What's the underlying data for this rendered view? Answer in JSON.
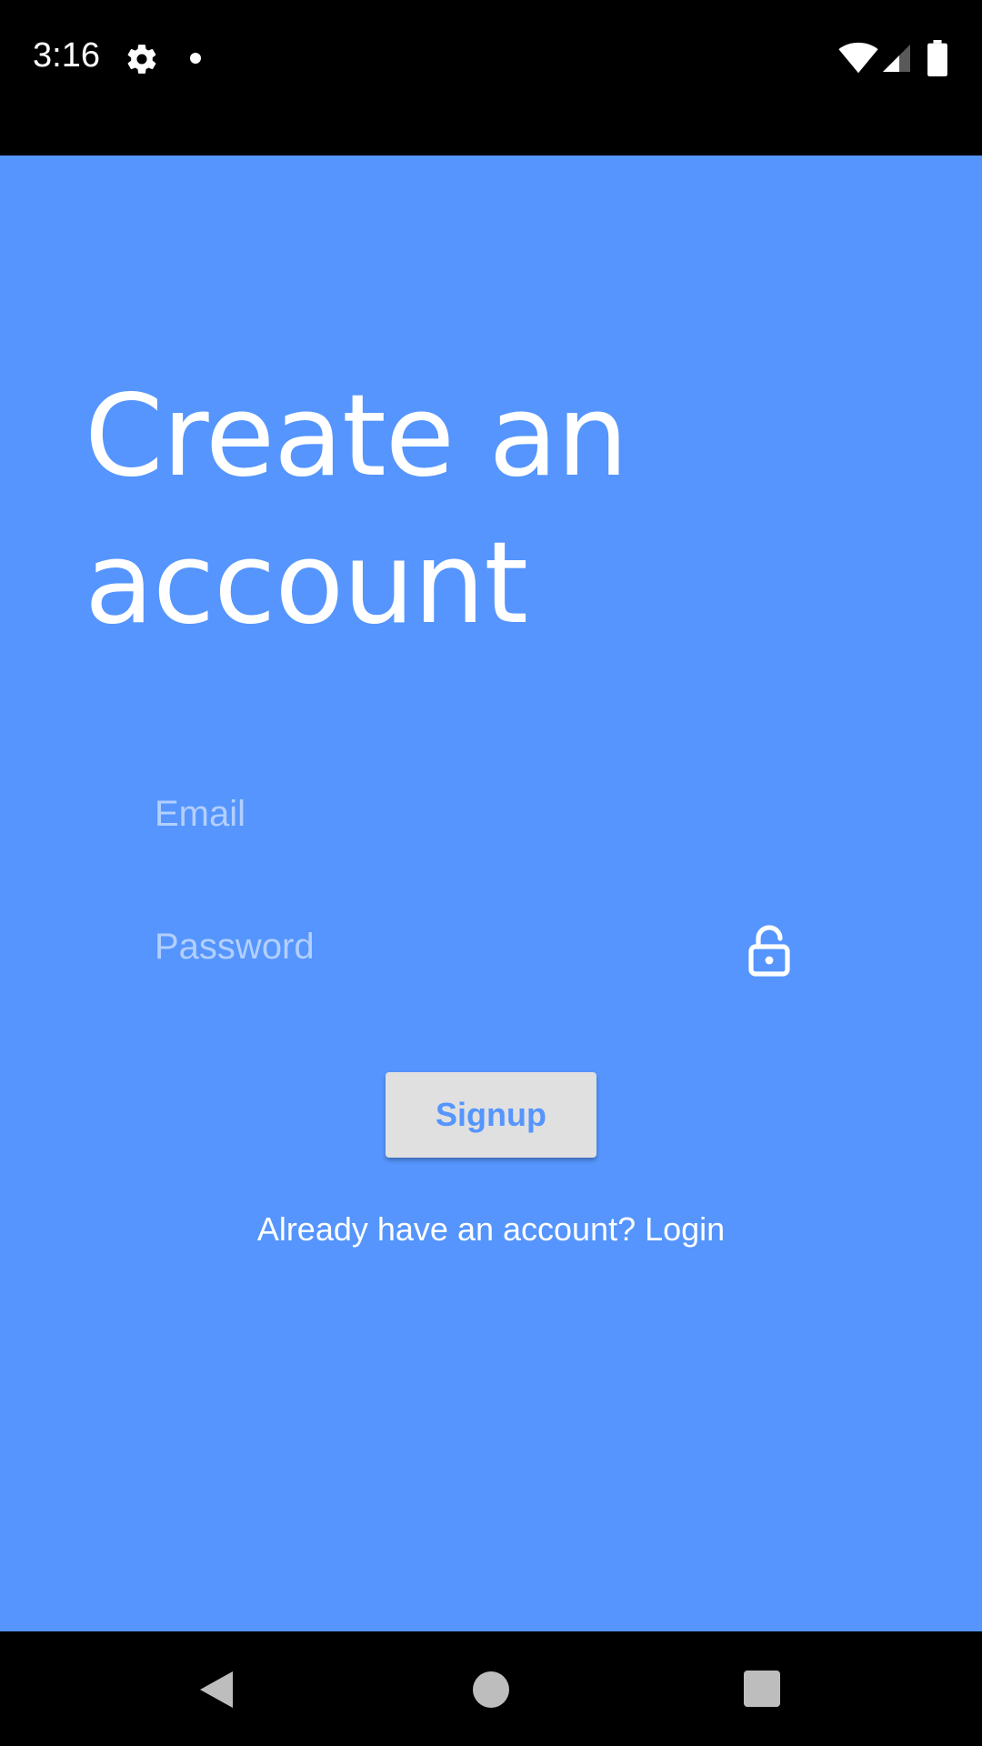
{
  "status_bar": {
    "time": "3:16",
    "icons": [
      "gear-icon",
      "dot-icon",
      "wifi-icon",
      "signal-icon",
      "battery-icon"
    ]
  },
  "screen": {
    "background_color": "#5595fd",
    "title": "Create an account",
    "email_field": {
      "placeholder": "Email",
      "value": ""
    },
    "password_field": {
      "placeholder": "Password",
      "value": ""
    },
    "lock_icon": "lock-icon",
    "signup_button": {
      "label": "Signup"
    },
    "login_link": {
      "text": "Already have an account? Login"
    }
  },
  "nav_bar": {
    "icons": [
      "back-icon",
      "home-icon",
      "recents-icon"
    ]
  }
}
